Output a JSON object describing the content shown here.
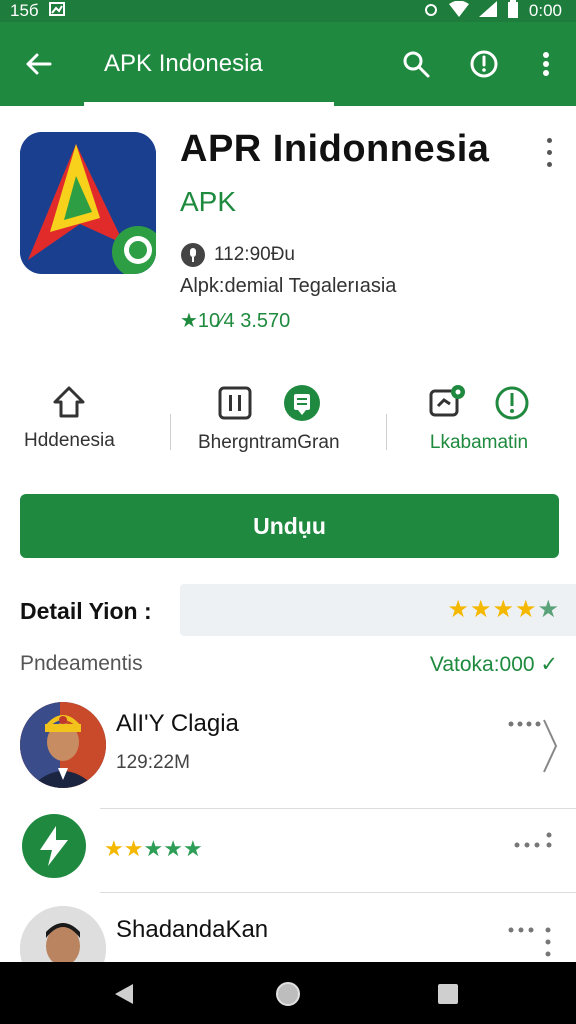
{
  "status_bar": {
    "time_left": "15б",
    "time_right": "0:00"
  },
  "app_bar": {
    "title": "APK Indonesia"
  },
  "app": {
    "name": "APR Inidonnesia",
    "developer": "APK",
    "downloads": "112:90Đu",
    "category": "Alpk:demial Tegalerıasia",
    "rating": "★10⁄4 3.570"
  },
  "actions": [
    {
      "label": "Hddenesia",
      "icon": "home-outline-icon"
    },
    {
      "label": "BhergntramGran",
      "icon": "pause-box-icon"
    },
    {
      "label": "Lkabamatin",
      "icon": "clock-badge-icon"
    }
  ],
  "install_button": {
    "label": "Undụu"
  },
  "detail": {
    "title": "Detail Yion :",
    "stars_filled": 4,
    "stars_total": 5
  },
  "section": {
    "label": "Pndeamentis",
    "link": "Vatoka:000 ✓"
  },
  "list": [
    {
      "title": "AlI'Y Clagia",
      "subtitle": "129:22M"
    },
    {
      "title": "",
      "subtitle": "★★★★★",
      "avatar_icon": "lightning-icon"
    },
    {
      "title": "ShadandaKan",
      "subtitle": ""
    }
  ],
  "colors": {
    "primary": "#1f8a3f",
    "primary_dark": "#1e7d3c",
    "star_gold": "#f5b800",
    "star_green": "#2e9e57"
  }
}
